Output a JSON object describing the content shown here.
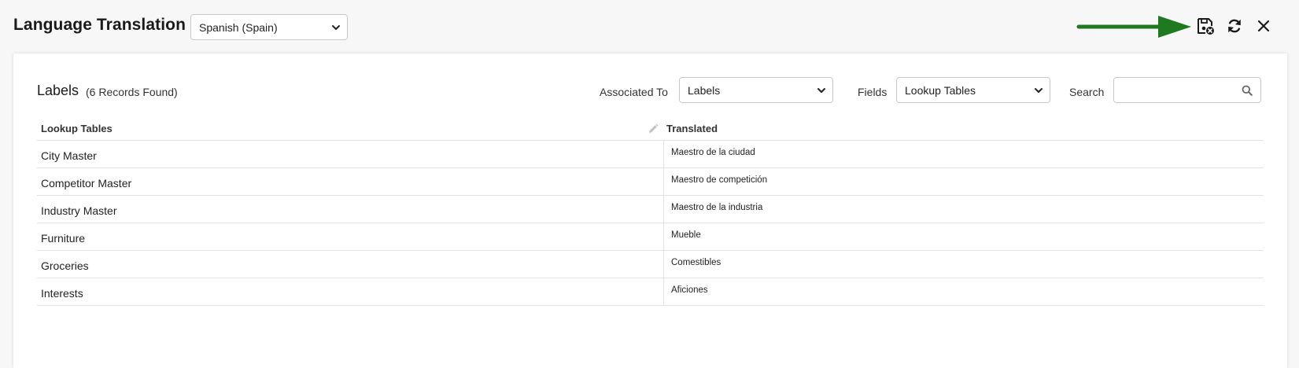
{
  "header": {
    "title": "Language Translation",
    "language_value": "Spanish (Spain)"
  },
  "toolbar": {
    "save_icon": "save-icon",
    "refresh_icon": "refresh-icon",
    "close_icon": "close-icon",
    "arrow_color": "#1e7a1e"
  },
  "panel": {
    "title": "Labels",
    "count": "(6 Records Found)",
    "associated_label": "Associated To",
    "associated_value": "Labels",
    "fields_label": "Fields",
    "fields_value": "Lookup Tables",
    "search_label": "Search",
    "search_value": ""
  },
  "table": {
    "columns": [
      "Lookup Tables",
      "Translated"
    ],
    "rows": [
      {
        "lookup": "City Master",
        "translated": "Maestro de la ciudad"
      },
      {
        "lookup": "Competitor Master",
        "translated": "Maestro de competición"
      },
      {
        "lookup": "Industry Master",
        "translated": "Maestro de la industria"
      },
      {
        "lookup": "Furniture",
        "translated": "Mueble"
      },
      {
        "lookup": "Groceries",
        "translated": "Comestibles"
      },
      {
        "lookup": "Interests",
        "translated": "Aficiones"
      }
    ]
  }
}
